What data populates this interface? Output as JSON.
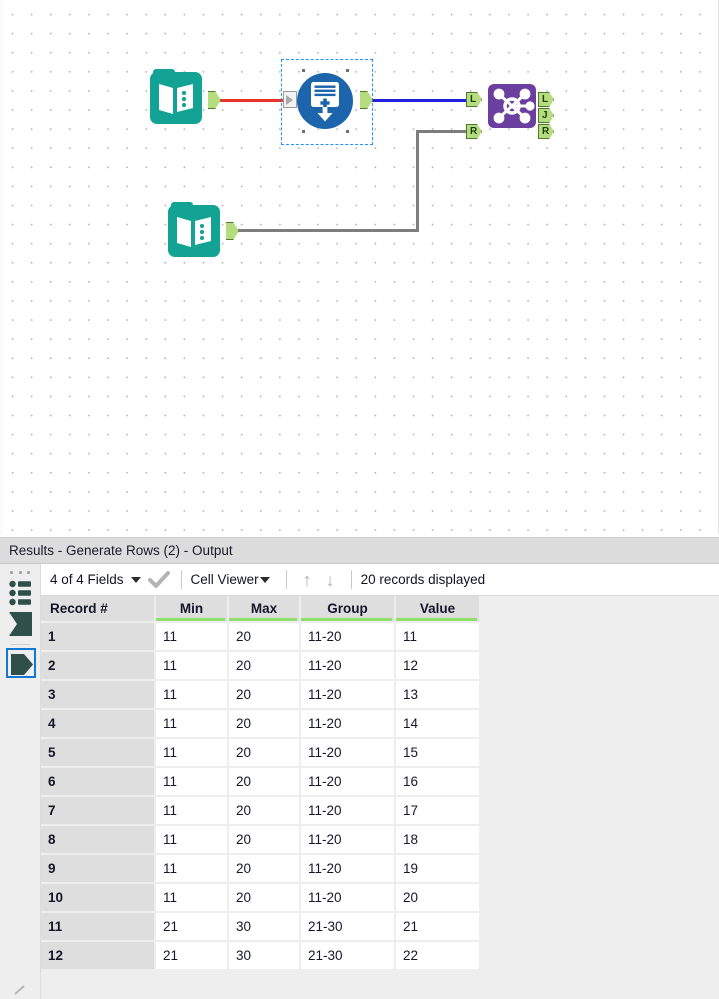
{
  "canvas": {
    "name": "workflow-canvas",
    "tools": [
      {
        "id": "input-data-1",
        "label": "Input Data",
        "icon": "book-icon",
        "color": "#13a394"
      },
      {
        "id": "generate-rows-2",
        "label": "Generate Rows",
        "icon": "generate-rows-icon",
        "color": "#1c64ab",
        "selected": true
      },
      {
        "id": "join-3",
        "label": "Join",
        "icon": "join-icon",
        "color": "#6b3fa0"
      },
      {
        "id": "input-data-4",
        "label": "Input Data",
        "icon": "book-icon",
        "color": "#13a394"
      }
    ],
    "connections": [
      {
        "from": "input-data-1",
        "to": "generate-rows-2",
        "color": "#e8322a"
      },
      {
        "from": "generate-rows-2",
        "to": "join-3-L",
        "color": "#2222dd"
      },
      {
        "from": "input-data-4",
        "to": "join-3-R",
        "color": "#7d7d7d"
      }
    ],
    "join_ports": {
      "inputs": [
        "L",
        "R"
      ],
      "outputs": [
        "L",
        "J",
        "R"
      ]
    }
  },
  "results": {
    "title": "Results - Generate Rows (2) - Output",
    "toolbar": {
      "fields_label": "4 of 4 Fields",
      "view_label": "Cell Viewer",
      "up_arrow": "↑",
      "down_arrow": "↓",
      "records_label": "20 records displayed",
      "check_glyph": "✔"
    },
    "rail": {
      "items": [
        {
          "name": "grip-dots-icon"
        },
        {
          "name": "list-icon"
        },
        {
          "name": "input-anchor-icon"
        },
        {
          "name": "output-anchor-icon",
          "selected": true
        }
      ]
    },
    "grid": {
      "columns": [
        "Record #",
        "Min",
        "Max",
        "Group",
        "Value"
      ],
      "rows": [
        [
          "1",
          "11",
          "20",
          "11-20",
          "11"
        ],
        [
          "2",
          "11",
          "20",
          "11-20",
          "12"
        ],
        [
          "3",
          "11",
          "20",
          "11-20",
          "13"
        ],
        [
          "4",
          "11",
          "20",
          "11-20",
          "14"
        ],
        [
          "5",
          "11",
          "20",
          "11-20",
          "15"
        ],
        [
          "6",
          "11",
          "20",
          "11-20",
          "16"
        ],
        [
          "7",
          "11",
          "20",
          "11-20",
          "17"
        ],
        [
          "8",
          "11",
          "20",
          "11-20",
          "18"
        ],
        [
          "9",
          "11",
          "20",
          "11-20",
          "19"
        ],
        [
          "10",
          "11",
          "20",
          "11-20",
          "20"
        ],
        [
          "11",
          "21",
          "30",
          "21-30",
          "21"
        ],
        [
          "12",
          "21",
          "30",
          "21-30",
          "22"
        ]
      ]
    }
  }
}
